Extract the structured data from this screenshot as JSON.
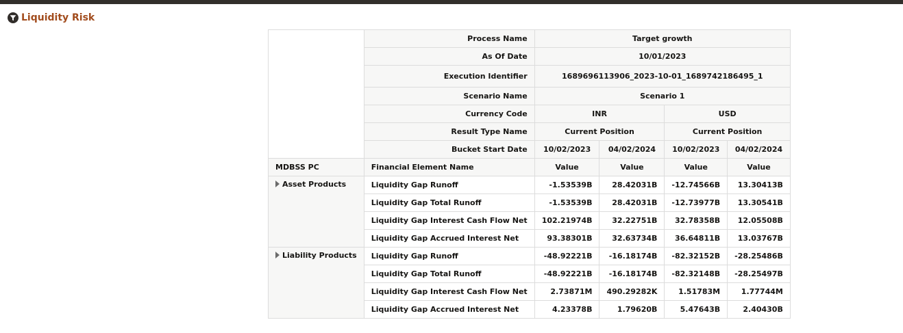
{
  "report": {
    "title": "Liquidity Risk"
  },
  "params": {
    "process_name_label": "Process Name",
    "process_name_value": "Target growth",
    "as_of_date_label": "As Of Date",
    "as_of_date_value": "10/01/2023",
    "execution_identifier_label": "Execution Identifier",
    "execution_identifier_value": "1689696113906_2023-10-01_1689742186495_1",
    "scenario_name_label": "Scenario Name",
    "scenario_name_value": "Scenario 1",
    "currency_code_label": "Currency Code",
    "currencies": [
      "INR",
      "USD"
    ],
    "result_type_label": "Result Type Name",
    "result_types": [
      "Current Position",
      "Current Position"
    ],
    "bucket_start_label": "Bucket Start Date",
    "bucket_dates": [
      "10/02/2023",
      "04/02/2024",
      "10/02/2023",
      "04/02/2024"
    ]
  },
  "columns": {
    "mdbss_pc": "MDBSS PC",
    "financial_element_name": "Financial Element Name",
    "value": "Value"
  },
  "groups": [
    {
      "name": "Asset Products",
      "rows": [
        {
          "element": "Liquidity Gap Runoff",
          "values": [
            "-1.53539B",
            "28.42031B",
            "-12.74566B",
            "13.30413B"
          ]
        },
        {
          "element": "Liquidity Gap Total Runoff",
          "values": [
            "-1.53539B",
            "28.42031B",
            "-12.73977B",
            "13.30541B"
          ]
        },
        {
          "element": "Liquidity Gap Interest Cash Flow Net",
          "values": [
            "102.21974B",
            "32.22751B",
            "32.78358B",
            "12.05508B"
          ]
        },
        {
          "element": "Liquidity Gap Accrued Interest Net",
          "values": [
            "93.38301B",
            "32.63734B",
            "36.64811B",
            "13.03767B"
          ]
        }
      ]
    },
    {
      "name": "Liability Products",
      "rows": [
        {
          "element": "Liquidity Gap Runoff",
          "values": [
            "-48.92221B",
            "-16.18174B",
            "-82.32152B",
            "-28.25486B"
          ]
        },
        {
          "element": "Liquidity Gap Total Runoff",
          "values": [
            "-48.92221B",
            "-16.18174B",
            "-82.32148B",
            "-28.25497B"
          ]
        },
        {
          "element": "Liquidity Gap Interest Cash Flow Net",
          "values": [
            "2.73871M",
            "490.29282K",
            "1.51783M",
            "1.77744M"
          ]
        },
        {
          "element": "Liquidity Gap Accrued Interest Net",
          "values": [
            "4.23378B",
            "1.79620B",
            "5.47643B",
            "2.40430B"
          ]
        }
      ]
    }
  ]
}
